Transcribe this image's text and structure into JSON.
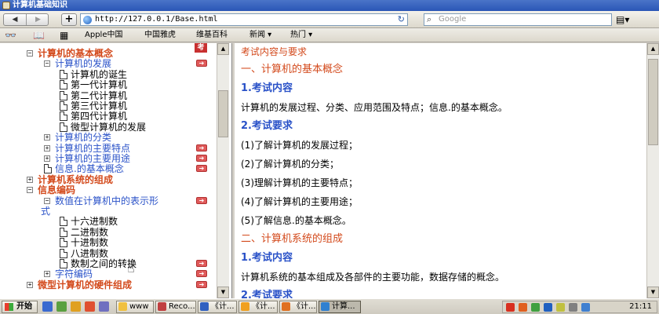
{
  "window": {
    "title": "计算机基础知识"
  },
  "toolbar": {
    "back": "◀",
    "forward": "▶",
    "new_tab": "+",
    "url": "http://127.0.0.1/Base.html",
    "search_placeholder": "Google",
    "reload": "↻",
    "search_icon": "search-icon"
  },
  "bookmarks": {
    "items": [
      "Apple中国",
      "中国雅虎",
      "维基百科",
      "新闻 ▾",
      "热门 ▾"
    ]
  },
  "tree": {
    "exam_badge": "考",
    "nodes": [
      {
        "level": 1,
        "toggle": "⊟",
        "label": "计算机的基本概念"
      },
      {
        "level": 2,
        "toggle": "⊟",
        "label": "计算机的发展",
        "arrow": true
      },
      {
        "level": 3,
        "label": "计算机的诞生"
      },
      {
        "level": 3,
        "label": "第一代计算机"
      },
      {
        "level": 3,
        "label": "第二代计算机"
      },
      {
        "level": 3,
        "label": "第三代计算机"
      },
      {
        "level": 3,
        "label": "第四代计算机"
      },
      {
        "level": 3,
        "label": "微型计算机的发展"
      },
      {
        "level": 2,
        "toggle": "⊞",
        "label": "计算机的分类"
      },
      {
        "level": 2,
        "toggle": "⊞",
        "label": "计算机的主要特点",
        "arrow": true
      },
      {
        "level": 2,
        "toggle": "⊞",
        "label": "计算机的主要用途",
        "arrow": true
      },
      {
        "level": 2,
        "doc": true,
        "label": "信息.的基本概念",
        "arrow": true
      },
      {
        "level": 1,
        "toggle": "⊞",
        "label": "计算机系统的组成"
      },
      {
        "level": 1,
        "toggle": "⊟",
        "label": "信息编码"
      },
      {
        "level": 2,
        "toggle": "⊟",
        "label": "数值在计算机中的表示形",
        "arrow": true
      },
      {
        "level": 2,
        "label": "式",
        "cont": true
      },
      {
        "level": 3,
        "label": "十六进制数"
      },
      {
        "level": 3,
        "label": "二进制数"
      },
      {
        "level": 3,
        "label": "十进制数"
      },
      {
        "level": 3,
        "label": "八进制数"
      },
      {
        "level": 3,
        "label": "数制之间的转换",
        "arrow": true
      },
      {
        "level": 2,
        "toggle": "⊞",
        "label": "字符编码",
        "arrow": true
      },
      {
        "level": 1,
        "toggle": "⊞",
        "label": "微型计算机的硬件组成",
        "arrow": true
      }
    ]
  },
  "content": {
    "lines": [
      {
        "kind": "head",
        "text": "考试内容与要求"
      },
      {
        "kind": "h1",
        "text": "一、计算机的基本概念"
      },
      {
        "kind": "h2",
        "text": "1.考试内容"
      },
      {
        "kind": "body",
        "text": "计算机的发展过程、分类、应用范围及特点；信息.的基本概念。"
      },
      {
        "kind": "h2",
        "text": "2.考试要求"
      },
      {
        "kind": "body",
        "text": "(1)了解计算机的发展过程；"
      },
      {
        "kind": "body",
        "text": "(2)了解计算机的分类；"
      },
      {
        "kind": "body",
        "text": "(3)理解计算机的主要特点；"
      },
      {
        "kind": "body",
        "text": "(4)了解计算机的主要用途；"
      },
      {
        "kind": "body",
        "text": "(5)了解信息.的基本概念。"
      },
      {
        "kind": "h1",
        "text": "二、计算机系统的组成"
      },
      {
        "kind": "h2",
        "text": "1.考试内容"
      },
      {
        "kind": "body",
        "text": "计算机系统的基本组成及各部件的主要功能，数据存储的概念。"
      },
      {
        "kind": "h2",
        "text": "2.考试要求"
      }
    ]
  },
  "taskbar": {
    "start": "开始",
    "tasks": [
      {
        "label": "www",
        "color": "#f0c040"
      },
      {
        "label": "Reco...",
        "color": "#c04040"
      },
      {
        "label": "《计...",
        "color": "#3060c0"
      },
      {
        "label": "《计...",
        "color": "#f0a020"
      },
      {
        "label": "《计...",
        "color": "#e07020"
      },
      {
        "label": "计算...",
        "color": "#3080d0",
        "active": true
      }
    ],
    "clock": "21:11"
  },
  "colors": {
    "accent_orange": "#d34a1c",
    "link_blue": "#2a52c8"
  }
}
